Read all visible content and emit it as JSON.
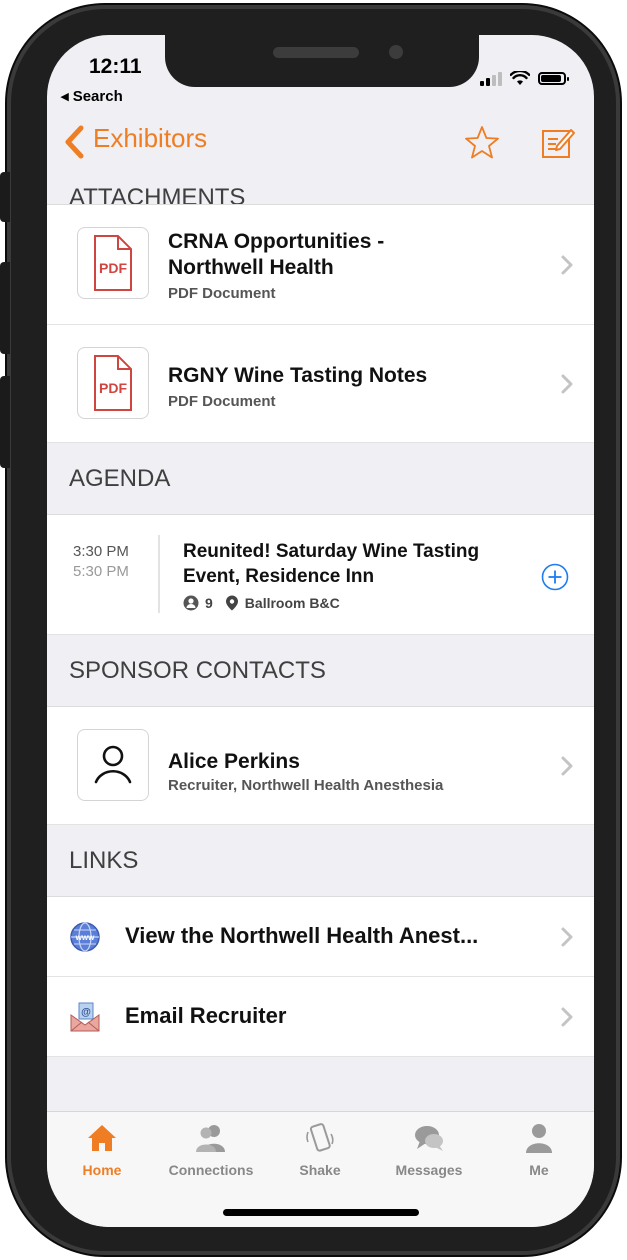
{
  "status": {
    "time": "12:11",
    "back_app": "◂ Search"
  },
  "nav": {
    "title": "Exhibitors",
    "back_icon": "chevron-left-icon",
    "favorite_icon": "star-icon",
    "notes_icon": "note-edit-icon",
    "accent": "#ef7d23"
  },
  "attachments": {
    "header": "ATTACHMENTS",
    "items": [
      {
        "title_line1": "CRNA Opportunities -",
        "title_line2": "Northwell Health",
        "subtitle": "PDF Document",
        "icon_text": "PDF"
      },
      {
        "title_line1": "RGNY Wine Tasting Notes",
        "title_line2": "",
        "subtitle": "PDF Document",
        "icon_text": "PDF"
      }
    ]
  },
  "agenda": {
    "header": "AGENDA",
    "items": [
      {
        "start": "3:30 PM",
        "end": "5:30 PM",
        "title_line1": "Reunited! Saturday Wine Tasting",
        "title_line2": "Event, Residence Inn",
        "attendees": "9",
        "location": "Ballroom B&C"
      }
    ]
  },
  "sponsor_contacts": {
    "header": "SPONSOR CONTACTS",
    "items": [
      {
        "name": "Alice Perkins",
        "role": "Recruiter, Northwell Health Anesthesia"
      }
    ]
  },
  "links": {
    "header": "LINKS",
    "items": [
      {
        "label": "View the Northwell Health Anest...",
        "icon": "globe-www-icon"
      },
      {
        "label": "Email Recruiter",
        "icon": "email-envelope-icon"
      }
    ]
  },
  "tabs": [
    {
      "label": "Home",
      "icon": "home-icon",
      "active": true
    },
    {
      "label": "Connections",
      "icon": "people-icon",
      "active": false
    },
    {
      "label": "Shake",
      "icon": "phone-shake-icon",
      "active": false
    },
    {
      "label": "Messages",
      "icon": "chat-bubbles-icon",
      "active": false
    },
    {
      "label": "Me",
      "icon": "person-icon",
      "active": false
    }
  ]
}
